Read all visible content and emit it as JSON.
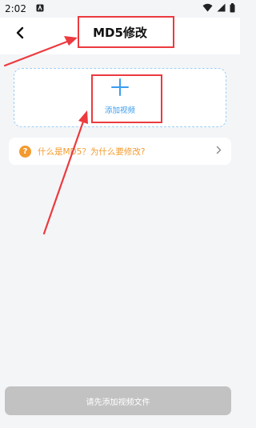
{
  "status_bar": {
    "time": "2:02",
    "notification_icon": "app-notification-icon",
    "wifi_icon": "wifi-icon",
    "signal_icon": "signal-icon",
    "battery_icon": "battery-icon"
  },
  "header": {
    "title": "MD5修改",
    "back_icon": "back-arrow-icon"
  },
  "add_video": {
    "label": "添加视频",
    "icon": "plus-icon",
    "accent": "#3a9cee"
  },
  "faq": {
    "text": "什么是MD5？为什么要修改?",
    "icon": "question-icon",
    "chevron": "chevron-right-icon",
    "color": "#f39a2e"
  },
  "footer": {
    "button_label": "请先添加视频文件"
  },
  "annotation": {
    "color": "#ec3a3f"
  }
}
